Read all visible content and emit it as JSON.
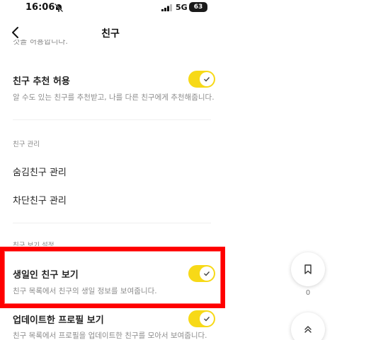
{
  "status_bar": {
    "time": "16:06",
    "network": "5G",
    "battery": "63"
  },
  "nav": {
    "title": "친구"
  },
  "clipped_text": "것을 허용합니다.",
  "settings": {
    "recommend": {
      "title": "친구 추천 허용",
      "desc": "알 수도 있는 친구를 추천받고, 나를 다른 친구에게 추천해줍니다.",
      "enabled": true
    },
    "manage_header": "친구 관리",
    "hidden_friends": "숨김친구 관리",
    "blocked_friends": "차단친구 관리",
    "view_header": "친구 보기 설정",
    "birthday": {
      "title": "생일인 친구 보기",
      "desc": "친구 목록에서 친구의 생일 정보를 보여줍니다.",
      "enabled": true
    },
    "updated_profile": {
      "title": "업데이트한 프로필 보기",
      "desc": "친구 목록에서 프로필을 업데이트한 친구를 모아서 보여줍니다.",
      "enabled": true
    }
  },
  "floating": {
    "bookmark_count": "0"
  },
  "colors": {
    "toggle_on": "#f7d917",
    "highlight": "#ff0000"
  }
}
